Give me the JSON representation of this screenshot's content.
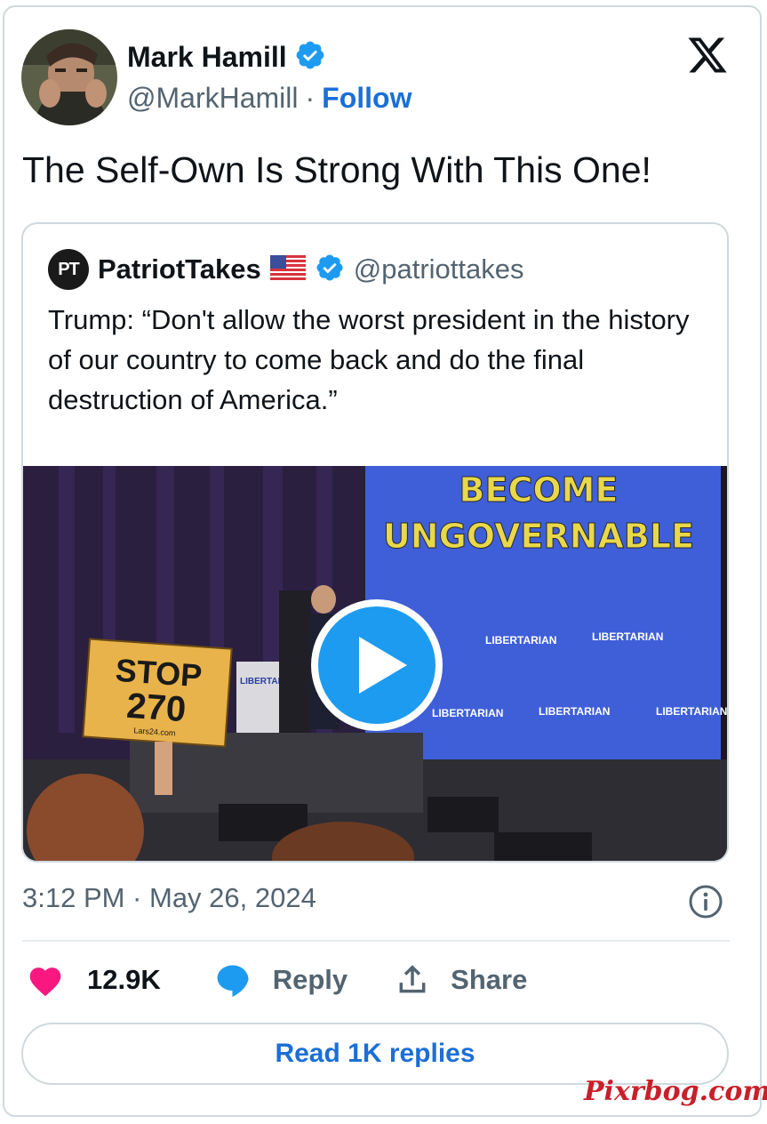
{
  "author": {
    "name": "Mark Hamill",
    "handle": "@MarkHamill",
    "separator": "·",
    "follow_label": "Follow"
  },
  "tweet": {
    "text": "The Self-Own Is Strong With This One!"
  },
  "quoted": {
    "logo_text": "PT",
    "name": "PatriotTakes",
    "handle": "@patriottakes",
    "text": "Trump: “Don't allow the worst president in the history of our country to come back and do the final destruction of America.”",
    "video": {
      "banner_text_line1": "BECOME",
      "banner_text_line2": "UNGOVERNABLE",
      "podium_text": "LIBERTARIAN",
      "sign_line1": "STOP",
      "sign_line2": "270",
      "sign_small": "Lars24.com"
    }
  },
  "meta": {
    "timestamp": "3:12 PM · May 26, 2024"
  },
  "actions": {
    "likes": "12.9K",
    "reply_label": "Reply",
    "share_label": "Share"
  },
  "read_replies_label": "Read 1K replies",
  "watermark": "Pixrbog.com",
  "colors": {
    "accent": "#1b6fd6",
    "verified": "#1d9bf0",
    "like": "#f91880",
    "muted": "#536471",
    "border": "#cfd9de"
  }
}
